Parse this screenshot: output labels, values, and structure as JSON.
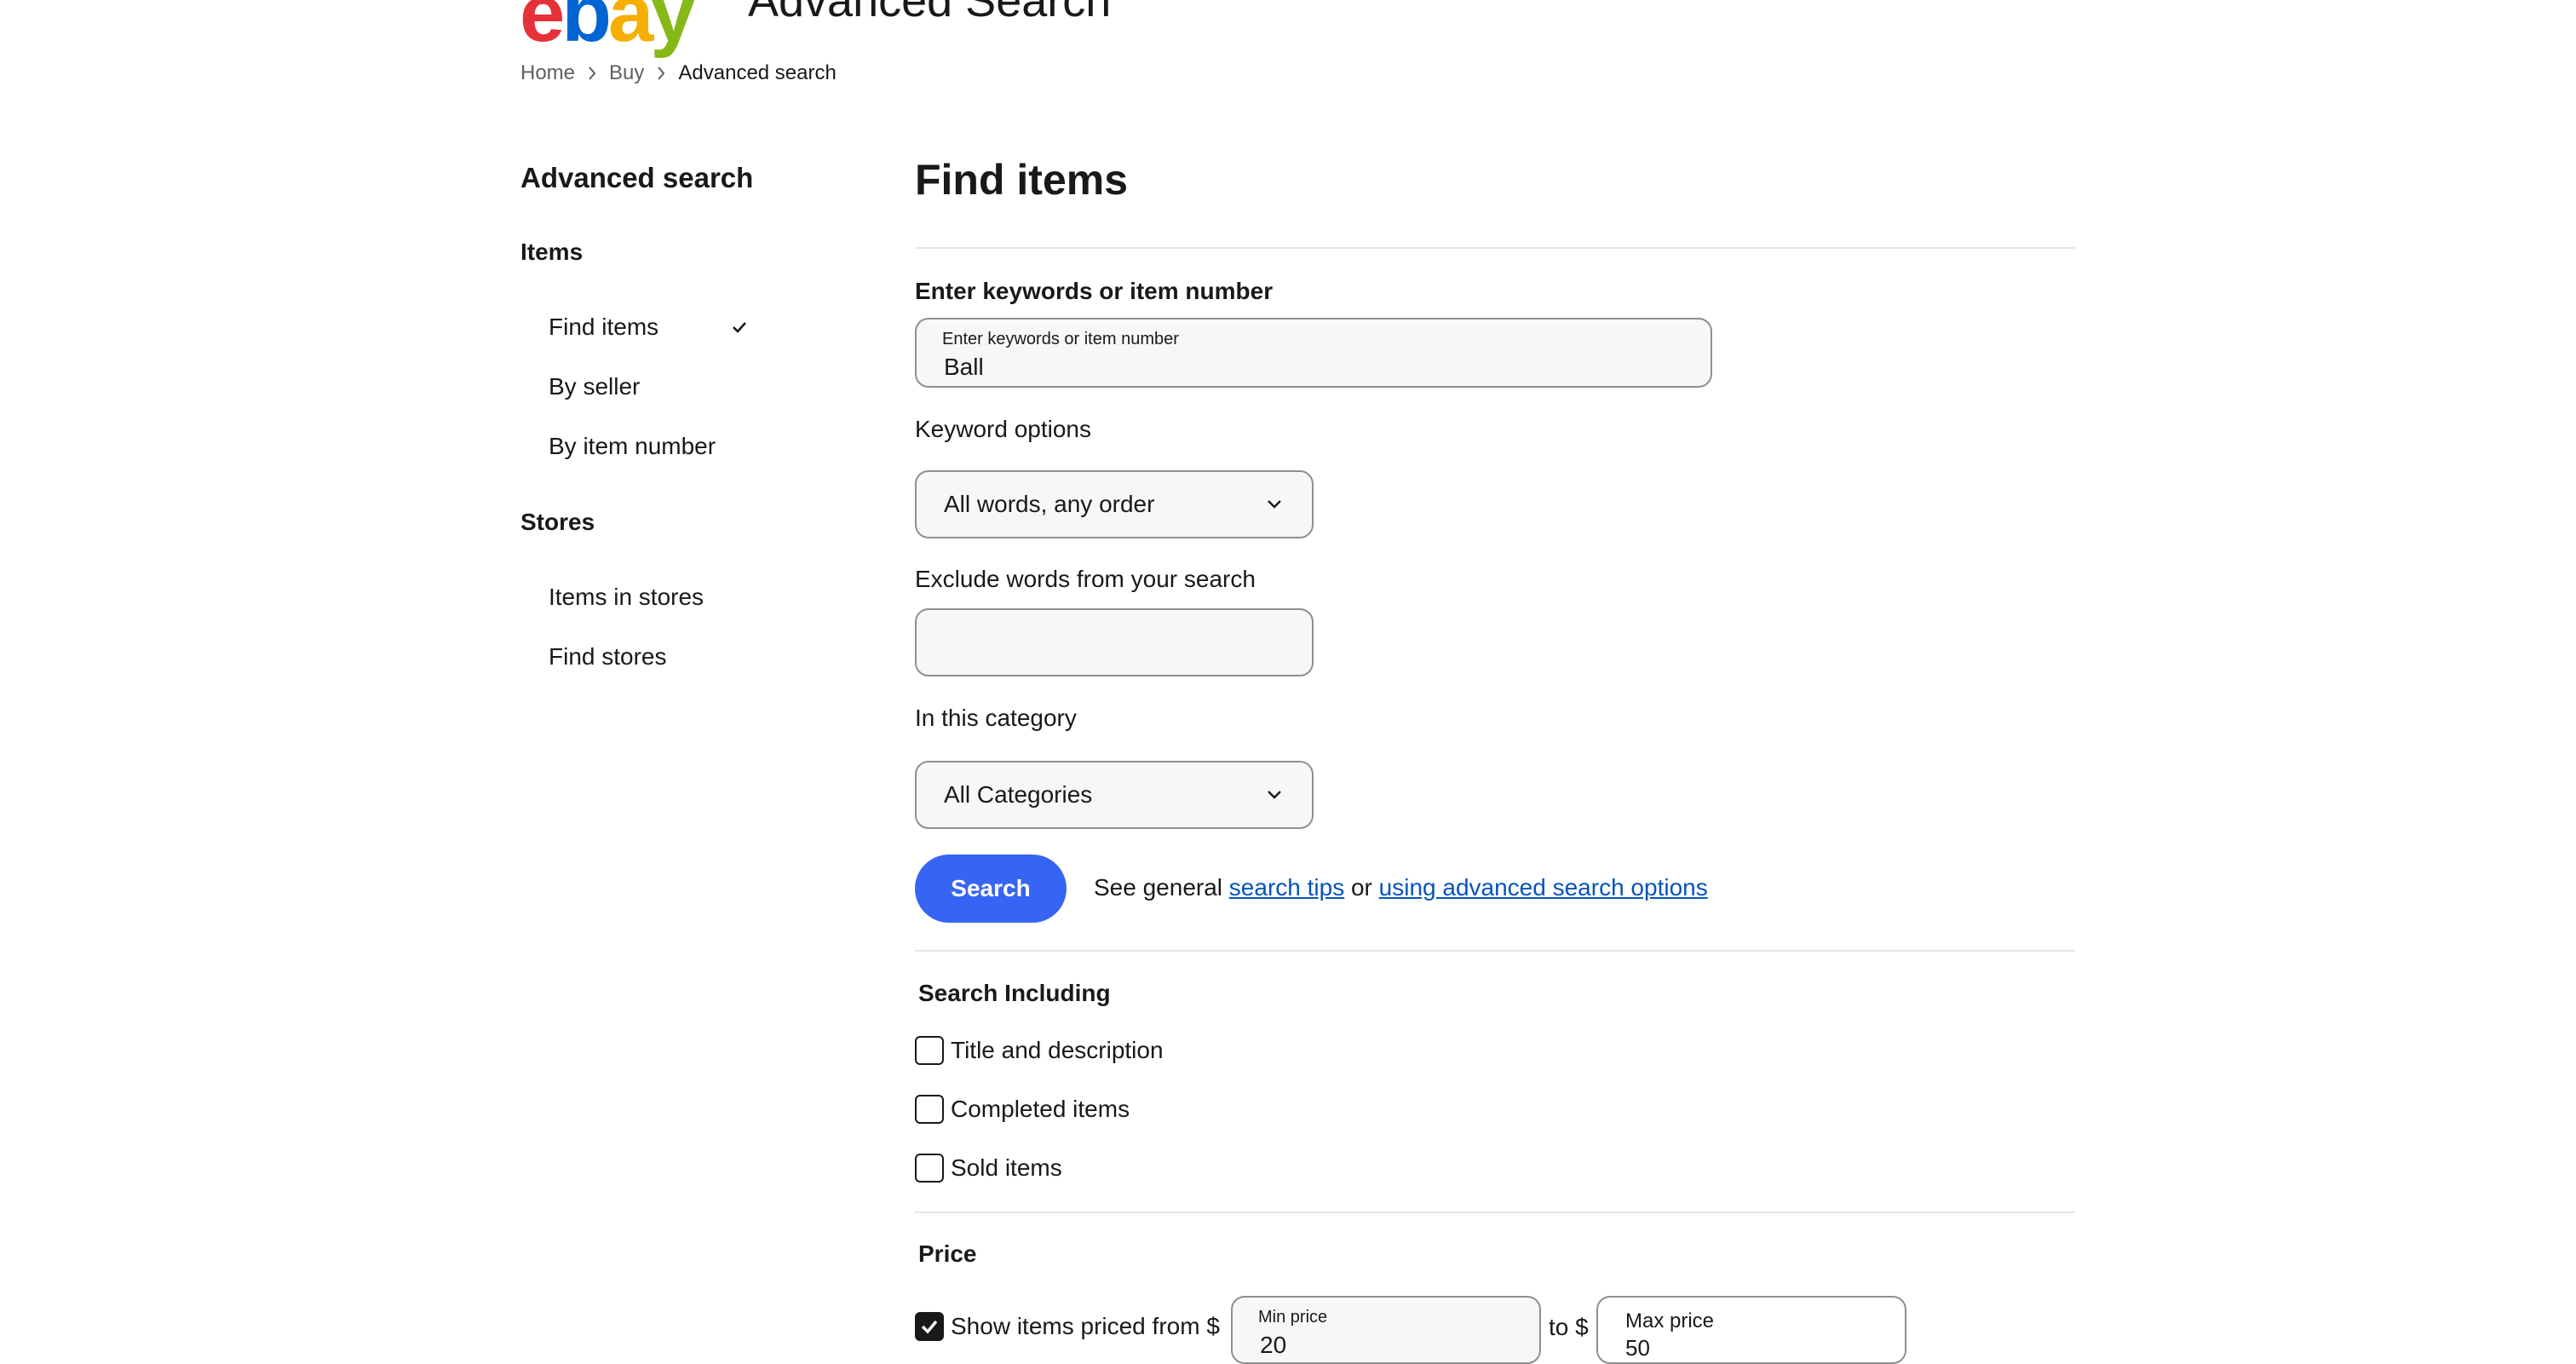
{
  "header": {
    "logo": {
      "e": "e",
      "b": "b",
      "a": "a",
      "y": "y"
    },
    "title": "Advanced Search"
  },
  "breadcrumb": [
    "Home",
    "Buy",
    "Advanced search"
  ],
  "sidebar": {
    "title": "Advanced search",
    "sections": [
      {
        "label": "Items",
        "items": [
          "Find items",
          "By seller",
          "By item number"
        ]
      },
      {
        "label": "Stores",
        "items": [
          "Items in stores",
          "Find stores"
        ]
      }
    ],
    "selected_item": "Find items"
  },
  "main": {
    "title": "Find items",
    "keywords": {
      "label": "Enter keywords or item number",
      "float_label": "Enter keywords or item number",
      "value": "Ball"
    },
    "keyword_options": {
      "label": "Keyword options",
      "value": "All words, any order"
    },
    "exclude": {
      "label": "Exclude words from your search",
      "value": ""
    },
    "category": {
      "label": "In this category",
      "value": "All Categories"
    },
    "search_button": "Search",
    "tips": {
      "prefix": "See general",
      "link1": "search tips",
      "middle": "or",
      "link2": "using advanced search options"
    },
    "search_including": {
      "title": "Search Including",
      "options": [
        {
          "label": "Title and description",
          "checked": false
        },
        {
          "label": "Completed items",
          "checked": false
        },
        {
          "label": "Sold items",
          "checked": false
        }
      ]
    },
    "price": {
      "title": "Price",
      "show_label": "Show items priced from $",
      "checked": true,
      "min_label": "Min price",
      "min_value": "20",
      "to_label": "to $",
      "max_label": "Max price",
      "max_value": "50"
    }
  },
  "colors": {
    "accent": "#3665f3",
    "link": "#0654ba",
    "text": "#191919",
    "field_bg": "#f7f7f7",
    "border": "#8f8f8f"
  },
  "icons": [
    "chevron-right-icon",
    "checkmark-icon",
    "chevron-down-icon",
    "checkbox-checked-icon"
  ]
}
